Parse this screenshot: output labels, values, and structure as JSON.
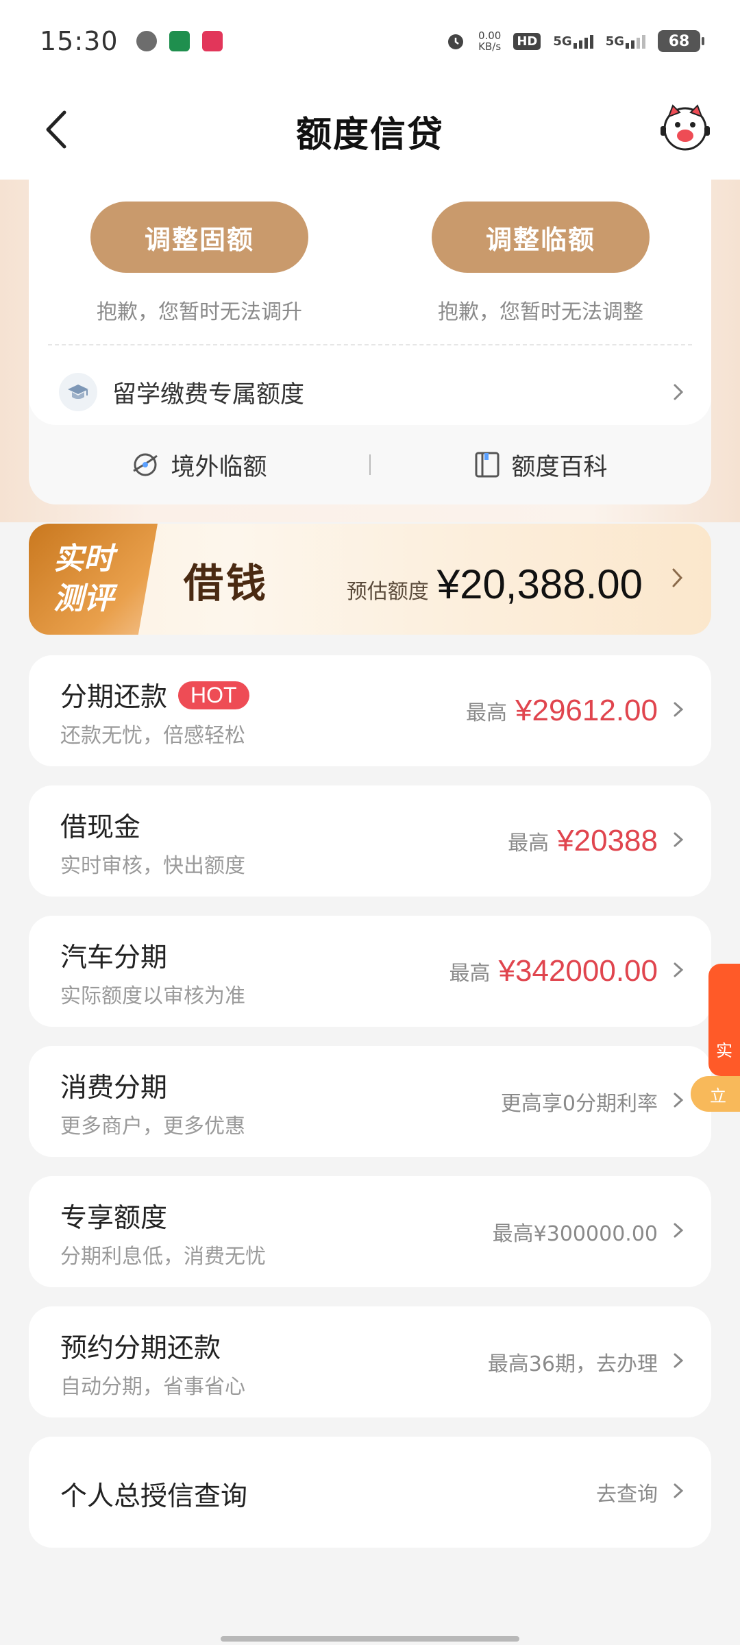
{
  "status": {
    "time": "15:30",
    "speed_value": "0.00",
    "speed_unit": "KB/s",
    "hd_label": "HD",
    "hd_index": "1 2",
    "net1": "5G",
    "net2": "5G",
    "battery": "68"
  },
  "header": {
    "title": "额度信贷"
  },
  "limits": {
    "fixed_button": "调整固额",
    "fixed_note": "抱歉，您暂时无法调升",
    "temp_button": "调整临额",
    "temp_note": "抱歉，您暂时无法调整",
    "study_label": "留学缴费专属额度",
    "overseas_label": "境外临额",
    "wiki_label": "额度百科"
  },
  "eval_banner": {
    "tag_line1": "实时",
    "tag_line2": "测评",
    "main": "借钱",
    "est_label": "预估额度",
    "est_amount": "¥20,388.00"
  },
  "items": [
    {
      "title": "分期还款",
      "badge": "HOT",
      "sub": "还款无忧，倍感轻松",
      "right_label": "最高",
      "right_amount": "¥29612.00"
    },
    {
      "title": "借现金",
      "sub": "实时审核，快出额度",
      "right_label": "最高",
      "right_amount": "¥20388"
    },
    {
      "title": "汽车分期",
      "sub": "实际额度以审核为准",
      "right_label": "最高",
      "right_amount": "¥342000.00"
    },
    {
      "title": "消费分期",
      "sub": "更多商户，更多优惠",
      "right_text": "更高享0分期利率"
    },
    {
      "title": "专享额度",
      "sub": "分期利息低，消费无忧",
      "right_text": "最高¥300000.00"
    },
    {
      "title": "预约分期还款",
      "sub": "自动分期，省事省心",
      "right_text": "最高36期，去办理"
    },
    {
      "title": "个人总授信查询",
      "right_text": "去查询"
    }
  ],
  "side_float": {
    "label": "实",
    "button": "立"
  }
}
